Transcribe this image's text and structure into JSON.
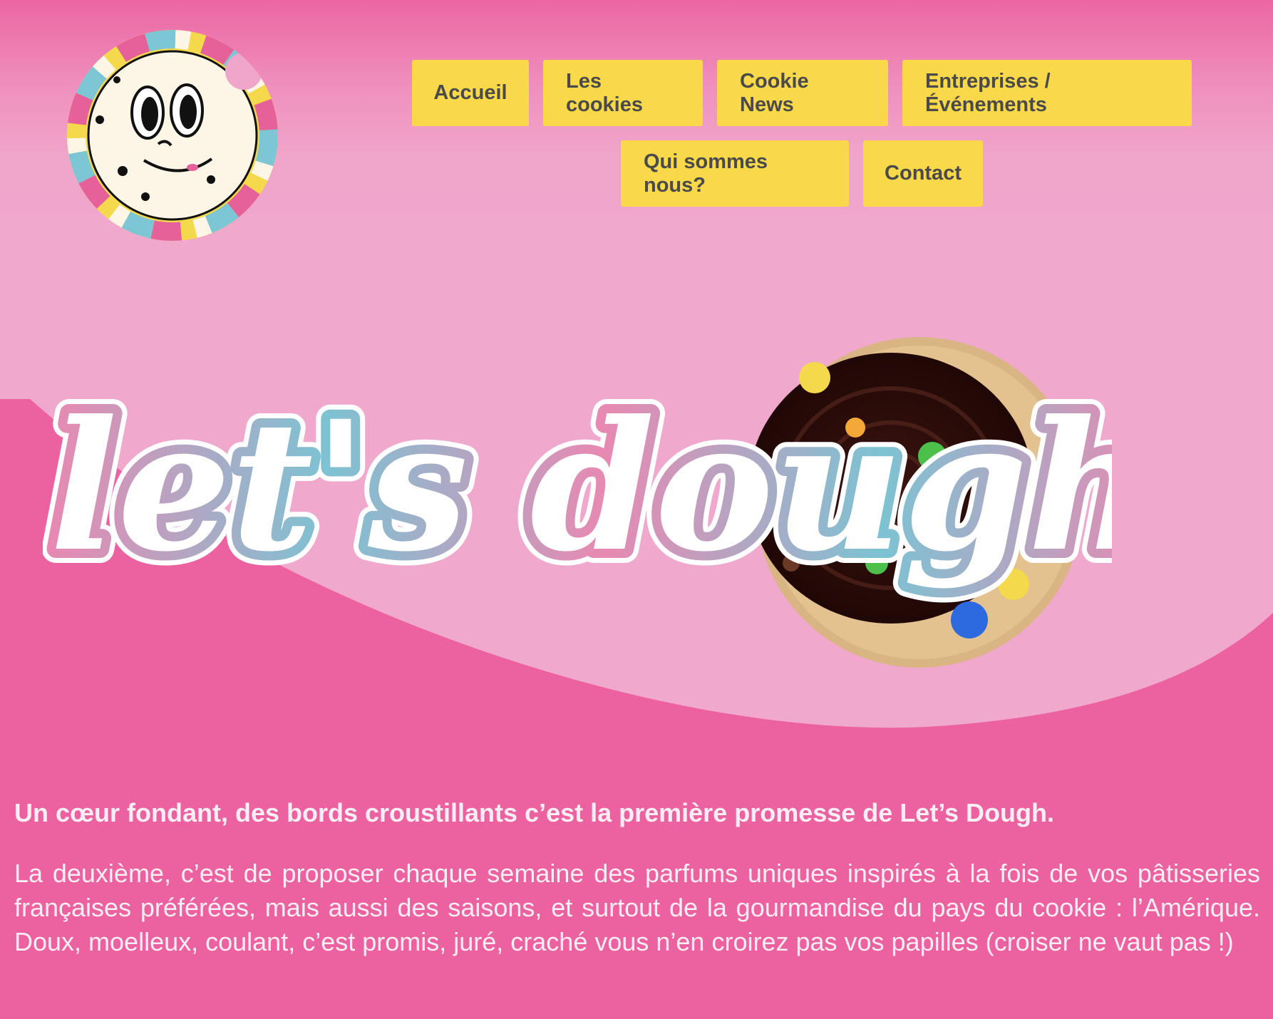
{
  "nav": {
    "row1": [
      "Accueil",
      "Les cookies",
      "Cookie News",
      "Entreprises / Événements"
    ],
    "row2": [
      "Qui sommes nous?",
      "Contact"
    ]
  },
  "hero": {
    "wordmark": "let's dough"
  },
  "content": {
    "lead": "Un cœur fondant, des bords croustillants c’est la première promesse de Let’s Dough.",
    "body": "La deuxième, c’est de proposer chaque semaine des parfums uniques inspirés à la fois de vos pâtisseries françaises préférées, mais aussi des saisons, et surtout de la gourmandise du pays du cookie : l’Amérique. Doux, moelleux, coulant, c’est promis, juré, craché vous n’en croirez pas vos papilles (croiser ne vaut pas !)"
  },
  "colors": {
    "background": "#ec619f",
    "hero_band": "#f0a8cd",
    "nav_button": "#f9d94a",
    "nav_text": "#4a4a4a",
    "body_text": "#fdeef3"
  },
  "icons": [
    "cookie-mascot-logo",
    "frosted-cookie-image"
  ]
}
